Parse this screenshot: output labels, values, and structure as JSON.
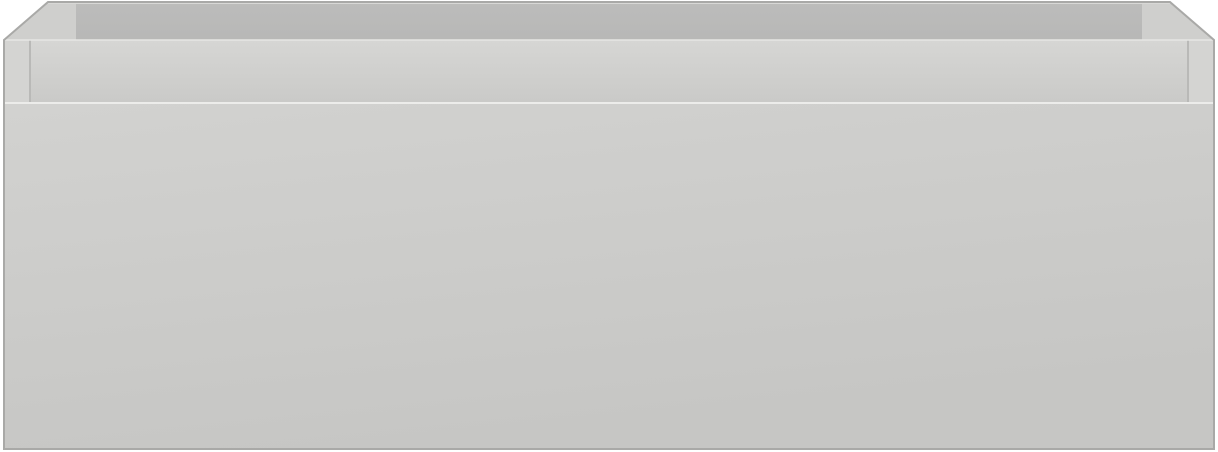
{
  "object": {
    "colors": {
      "background": "#ffffff",
      "front_top": "#d2d2d0",
      "front_bottom": "#c6c6c4",
      "rim_light": "#d6d6d4",
      "rim_dark": "#cacac8",
      "interior": "#bcbcbb",
      "interior_shadow": "#b0b0af",
      "edge": "#a9a9a7",
      "highlight": "#ececea"
    }
  }
}
